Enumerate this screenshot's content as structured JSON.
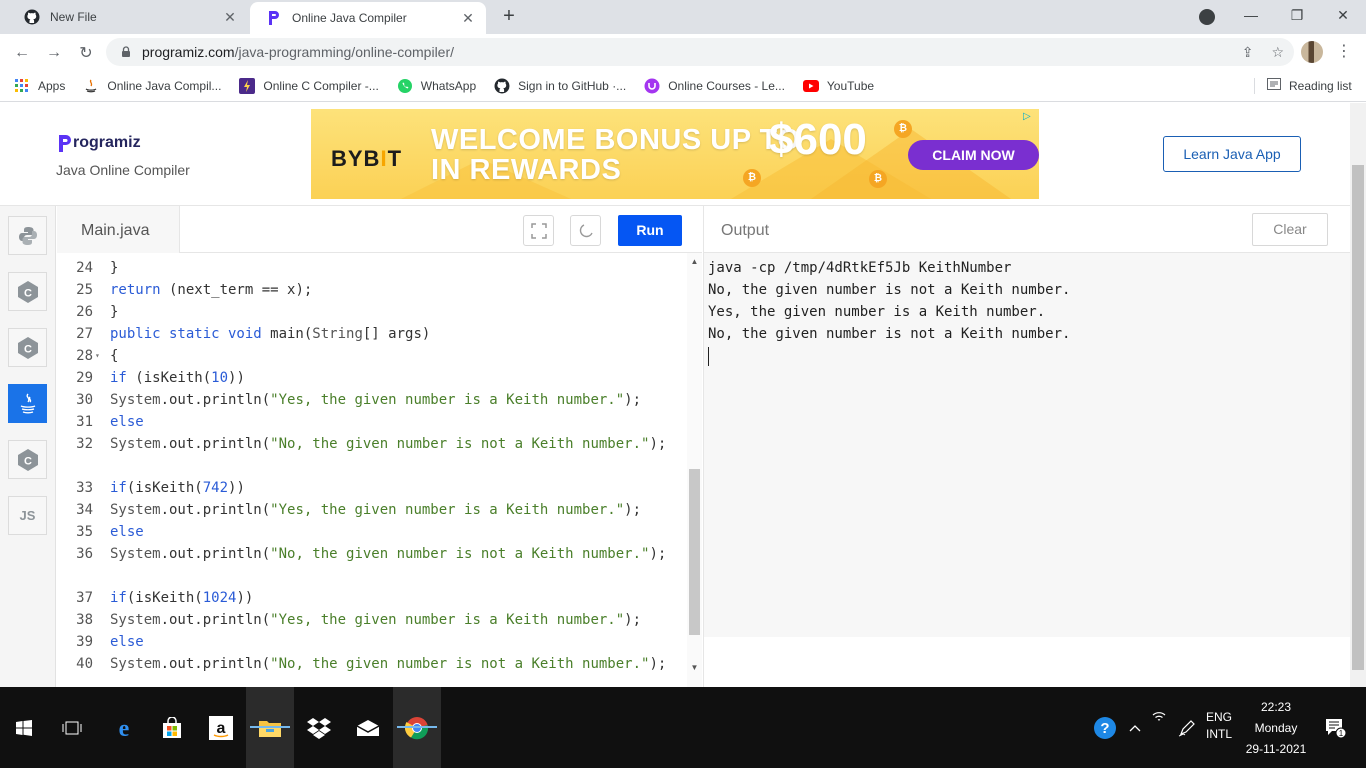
{
  "browser": {
    "tabs": [
      {
        "title": "New File",
        "icon": "github-icon",
        "active": false
      },
      {
        "title": "Online Java Compiler",
        "icon": "programiz-icon",
        "active": true
      }
    ],
    "url_host": "programiz.com",
    "url_path": "/java-programming/online-compiler/",
    "bookmarks": [
      {
        "label": "Apps",
        "icon": "apps-grid-icon"
      },
      {
        "label": "Online Java Compil...",
        "icon": "java-icon"
      },
      {
        "label": "Online C Compiler -...",
        "icon": "compiler-icon"
      },
      {
        "label": "WhatsApp",
        "icon": "whatsapp-icon"
      },
      {
        "label": "Sign in to GitHub ·...",
        "icon": "github-icon"
      },
      {
        "label": "Online Courses - Le...",
        "icon": "udemy-icon"
      },
      {
        "label": "YouTube",
        "icon": "youtube-icon"
      }
    ],
    "reading_list": "Reading list"
  },
  "header": {
    "logo_text": "rogramiz",
    "subtitle": "Java Online Compiler",
    "learn_button": "Learn Java App"
  },
  "ad": {
    "brand_a": "BYB",
    "brand_bar": "I",
    "brand_b": "T",
    "headline_1": "WELCOME BONUS UP TO",
    "headline_2": "IN REWARDS",
    "amount": "$600",
    "cta": "CLAIM NOW"
  },
  "languages": [
    "python",
    "c",
    "cpp",
    "java",
    "csharp",
    "JS"
  ],
  "editor": {
    "file_name": "Main.java",
    "run_label": "Run",
    "lines": [
      {
        "n": "24",
        "fold": false,
        "parts": [
          [
            "tx",
            "}"
          ]
        ]
      },
      {
        "n": "25",
        "fold": false,
        "parts": [
          [
            "kw",
            "return"
          ],
          [
            "tx",
            " (next_term == x);"
          ]
        ]
      },
      {
        "n": "26",
        "fold": false,
        "parts": [
          [
            "tx",
            "}"
          ]
        ]
      },
      {
        "n": "27",
        "fold": false,
        "parts": [
          [
            "kw",
            "public static void"
          ],
          [
            "tx",
            " main("
          ],
          [
            "cls",
            "String"
          ],
          [
            "tx",
            "[] args)"
          ]
        ]
      },
      {
        "n": "28",
        "fold": true,
        "parts": [
          [
            "tx",
            "{"
          ]
        ]
      },
      {
        "n": "29",
        "fold": false,
        "parts": [
          [
            "kw",
            "if"
          ],
          [
            "tx",
            " (isKeith("
          ],
          [
            "num",
            "10"
          ],
          [
            "tx",
            "))"
          ]
        ]
      },
      {
        "n": "30",
        "fold": false,
        "parts": [
          [
            "cls",
            "System"
          ],
          [
            "tx",
            ".out.println("
          ],
          [
            "str",
            "\"Yes, the given number is a Keith number.\""
          ],
          [
            "tx",
            ");"
          ]
        ]
      },
      {
        "n": "31",
        "fold": false,
        "parts": [
          [
            "kw",
            "else"
          ]
        ]
      },
      {
        "n": "32",
        "fold": false,
        "parts": [
          [
            "cls",
            "System"
          ],
          [
            "tx",
            ".out.println("
          ],
          [
            "str",
            "\"No, the given number is not a Keith number.\""
          ],
          [
            "tx",
            ");"
          ]
        ]
      },
      {
        "n": "",
        "fold": false,
        "parts": []
      },
      {
        "n": "33",
        "fold": false,
        "parts": [
          [
            "kw",
            "if"
          ],
          [
            "tx",
            "(isKeith("
          ],
          [
            "num",
            "742"
          ],
          [
            "tx",
            "))"
          ]
        ]
      },
      {
        "n": "34",
        "fold": false,
        "parts": [
          [
            "cls",
            "System"
          ],
          [
            "tx",
            ".out.println("
          ],
          [
            "str",
            "\"Yes, the given number is a Keith number.\""
          ],
          [
            "tx",
            ");"
          ]
        ]
      },
      {
        "n": "35",
        "fold": false,
        "parts": [
          [
            "kw",
            "else"
          ]
        ]
      },
      {
        "n": "36",
        "fold": false,
        "parts": [
          [
            "cls",
            "System"
          ],
          [
            "tx",
            ".out.println("
          ],
          [
            "str",
            "\"No, the given number is not a Keith number.\""
          ],
          [
            "tx",
            ");"
          ]
        ]
      },
      {
        "n": "",
        "fold": false,
        "parts": []
      },
      {
        "n": "37",
        "fold": false,
        "parts": [
          [
            "kw",
            "if"
          ],
          [
            "tx",
            "(isKeith("
          ],
          [
            "num",
            "1024"
          ],
          [
            "tx",
            "))"
          ]
        ]
      },
      {
        "n": "38",
        "fold": false,
        "parts": [
          [
            "cls",
            "System"
          ],
          [
            "tx",
            ".out.println("
          ],
          [
            "str",
            "\"Yes, the given number is a Keith number.\""
          ],
          [
            "tx",
            ");"
          ]
        ]
      },
      {
        "n": "39",
        "fold": false,
        "parts": [
          [
            "kw",
            "else"
          ]
        ]
      },
      {
        "n": "40",
        "fold": false,
        "parts": [
          [
            "cls",
            "System"
          ],
          [
            "tx",
            ".out.println("
          ],
          [
            "str",
            "\"No, the given number is not a Keith number.\""
          ],
          [
            "tx",
            ");"
          ]
        ]
      }
    ]
  },
  "output": {
    "title": "Output",
    "clear_label": "Clear",
    "lines": [
      "java -cp /tmp/4dRtkEf5Jb KeithNumber",
      "No, the given number is not a Keith number.",
      "Yes, the given number is a Keith number.",
      "No, the given number is not a Keith number."
    ]
  },
  "taskbar": {
    "apps": [
      "edge-icon",
      "store-icon",
      "amazon-icon",
      "file-explorer-icon",
      "dropbox-icon",
      "mail-icon",
      "chrome-icon"
    ],
    "lang_1": "ENG",
    "lang_2": "INTL",
    "time": "22:23",
    "day": "Monday",
    "date": "29-11-2021",
    "notifications": "1"
  },
  "colors": {
    "accent": "#0556f3",
    "active_lang": "#1a73e8",
    "learn_btn": "#1a5fb4",
    "ad_cta": "#7a2fd0"
  }
}
